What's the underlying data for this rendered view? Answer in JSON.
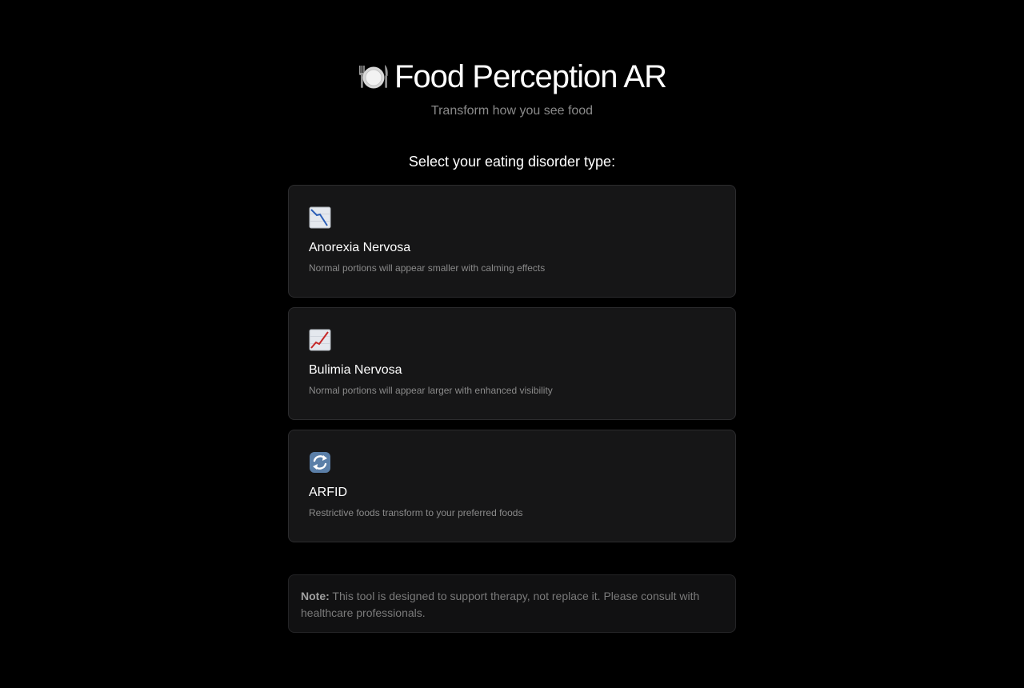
{
  "header": {
    "title": "Food Perception AR",
    "subtitle": "Transform how you see food",
    "icon": "plate-with-cutlery-icon"
  },
  "prompt": "Select your eating disorder type:",
  "options": [
    {
      "title": "Anorexia Nervosa",
      "description": "Normal portions will appear smaller with calming effects",
      "icon": "chart-decreasing-icon"
    },
    {
      "title": "Bulimia Nervosa",
      "description": "Normal portions will appear larger with enhanced visibility",
      "icon": "chart-increasing-icon"
    },
    {
      "title": "ARFID",
      "description": "Restrictive foods transform to your preferred foods",
      "icon": "arrows-cycle-icon"
    }
  ],
  "note": {
    "label": "Note:",
    "text": " This tool is designed to support therapy, not replace it. Please consult with healthcare professionals."
  },
  "colors": {
    "background": "#000000",
    "card": "#161617",
    "card_border": "#2c2c2e",
    "muted_text": "#8a8a8a",
    "chart_down": "#2b5fb8",
    "chart_up": "#c62828",
    "cycle_arrows": "#5b7fa8"
  }
}
